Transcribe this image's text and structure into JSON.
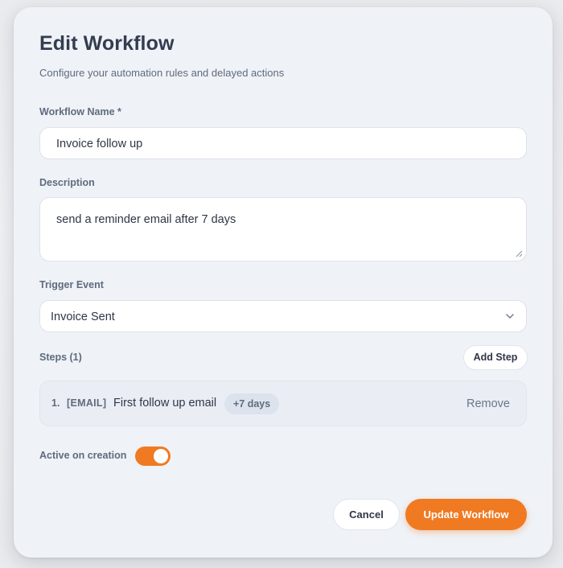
{
  "dialog": {
    "title": "Edit Workflow",
    "subtitle": "Configure your automation rules and delayed actions"
  },
  "fields": {
    "name": {
      "label": "Workflow Name *",
      "value": "Invoice follow up"
    },
    "description": {
      "label": "Description",
      "value": "send a reminder email after 7 days"
    },
    "trigger": {
      "label": "Trigger Event",
      "selected": "Invoice Sent"
    }
  },
  "steps": {
    "label": "Steps (1)",
    "add_label": "Add Step",
    "items": [
      {
        "number": "1.",
        "type": "[EMAIL]",
        "name": "First follow up email",
        "delay": "+7 days",
        "remove_label": "Remove"
      }
    ]
  },
  "active": {
    "label": "Active on creation",
    "enabled": true
  },
  "footer": {
    "cancel_label": "Cancel",
    "submit_label": "Update Workflow"
  },
  "colors": {
    "accent": "#f07a22",
    "panel_bg": "#eff2f7",
    "text_primary": "#333d4f",
    "text_secondary": "#5f6b7e"
  },
  "icons": {
    "select_indicator": "chevron-down-icon",
    "textarea_resize": "resize-grip-icon"
  }
}
